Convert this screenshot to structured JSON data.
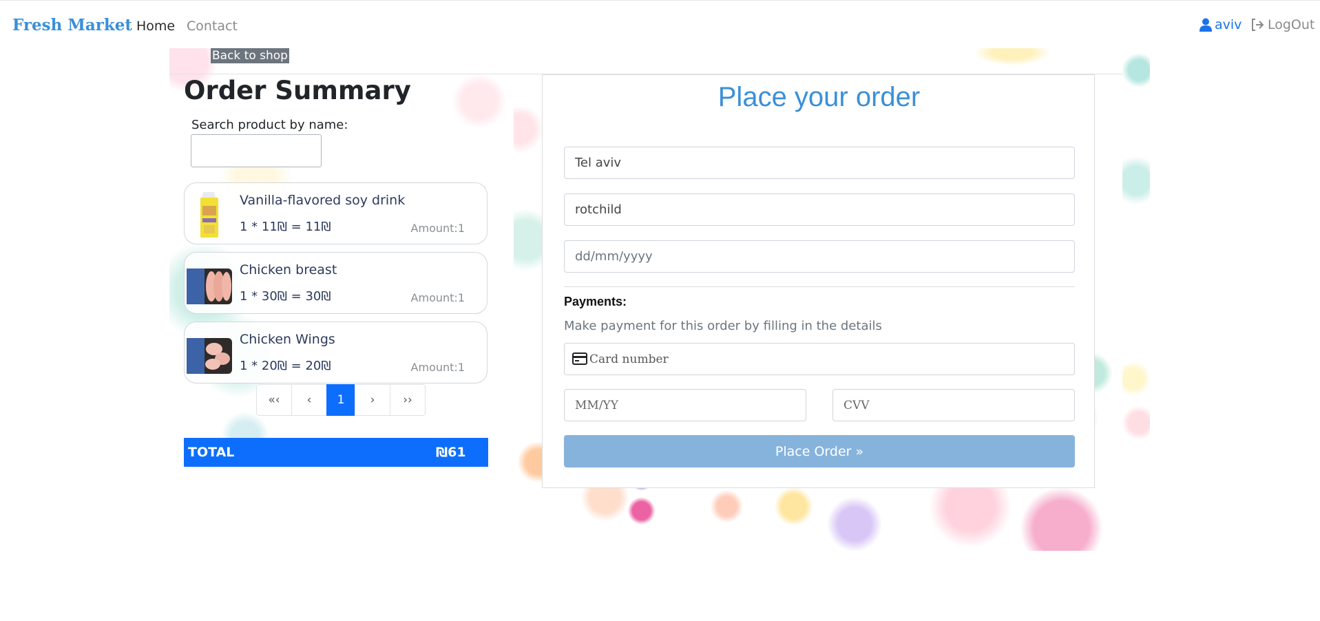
{
  "navbar": {
    "brand": "Fresh Market",
    "links": [
      "Home",
      "Contact"
    ],
    "user_name": "aviv",
    "logout_label": "LogOut"
  },
  "back_link": "Back to shop",
  "summary": {
    "title": "Order Summary",
    "search_label": "Search product by name:",
    "search_value": "",
    "products": [
      {
        "name": "Vanilla-flavored soy drink",
        "price_line": "1 * 11₪ = 11₪",
        "amount": "Amount:1"
      },
      {
        "name": "Chicken breast",
        "price_line": "1 * 30₪ = 30₪",
        "amount": "Amount:1"
      },
      {
        "name": "Chicken Wings",
        "price_line": "1 * 20₪ = 20₪",
        "amount": "Amount:1"
      }
    ],
    "pagination": [
      "«‹",
      "‹",
      "1",
      "›",
      "››"
    ],
    "total_label": "TOTAL",
    "total_value": "₪61"
  },
  "form": {
    "title": "Place your order",
    "city_value": "Tel aviv",
    "street_value": "rotchild",
    "date_placeholder": "dd/mm/yyyy",
    "payments_label": "Payments:",
    "payments_desc": "Make payment for this order by filling in the details",
    "card_placeholder": "Card number",
    "expiry_placeholder": "MM/YY",
    "cvv_placeholder": "CVV",
    "submit_label": "Place Order »"
  },
  "colors": {
    "brand": "#3a8fd9",
    "primary": "#0d6efd",
    "submit": "#86b3dc",
    "back_link_bg": "#6c757d"
  }
}
